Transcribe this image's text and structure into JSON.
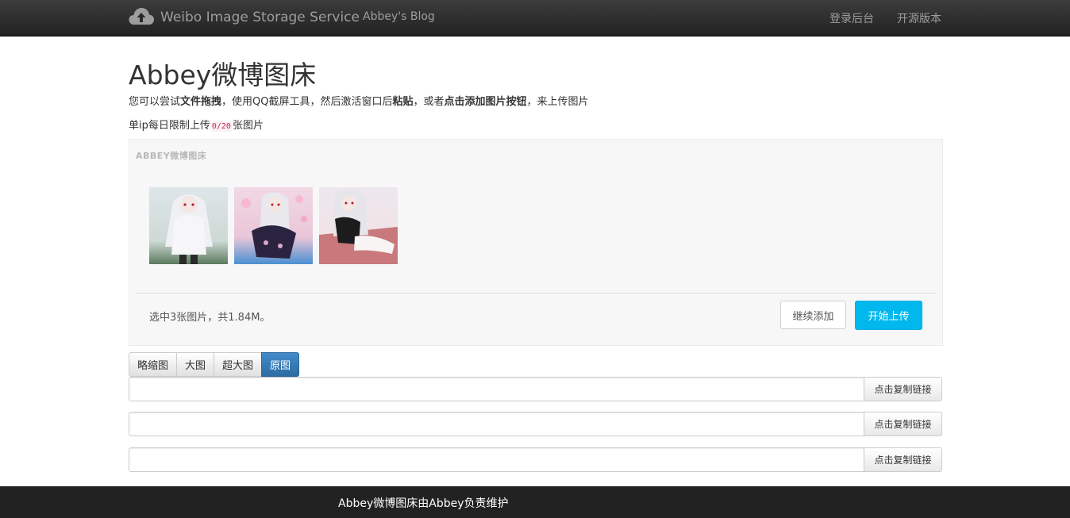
{
  "navbar": {
    "brand": "Weibo Image Storage Service",
    "blog_link": "Abbey's Blog",
    "login_link": "登录后台",
    "open_source_link": "开源版本"
  },
  "header": {
    "title": "Abbey微博图床",
    "intro": {
      "p1": "您可以尝试",
      "b1": "文件拖拽",
      "p2": "，使用QQ截屏工具，然后激活窗口后",
      "b2": "粘贴",
      "p3": "，或者",
      "b3": "点击添加图片按钮",
      "p4": "，来上传图片"
    },
    "limit": {
      "prefix": "单ip每日限制上传",
      "count": "0/20",
      "suffix": "张图片"
    }
  },
  "uploader": {
    "label": "ABBEY微博图床",
    "status": "选中3张图片，共1.84M。",
    "continue_button": "继续添加",
    "upload_button": "开始上传"
  },
  "size_tabs": [
    "略缩图",
    "大图",
    "超大图",
    "原图"
  ],
  "active_tab": "原图",
  "links": [
    {
      "value": "",
      "copy_label": "点击复制链接"
    },
    {
      "value": "",
      "copy_label": "点击复制链接"
    },
    {
      "value": "",
      "copy_label": "点击复制链接"
    }
  ],
  "footer": {
    "text": "Abbey微博图床由Abbey负责维护"
  },
  "colors": {
    "navbar": "#222222",
    "upload_button": "#00b7ee",
    "active_tab": "#428bca",
    "footer": "#222222"
  }
}
